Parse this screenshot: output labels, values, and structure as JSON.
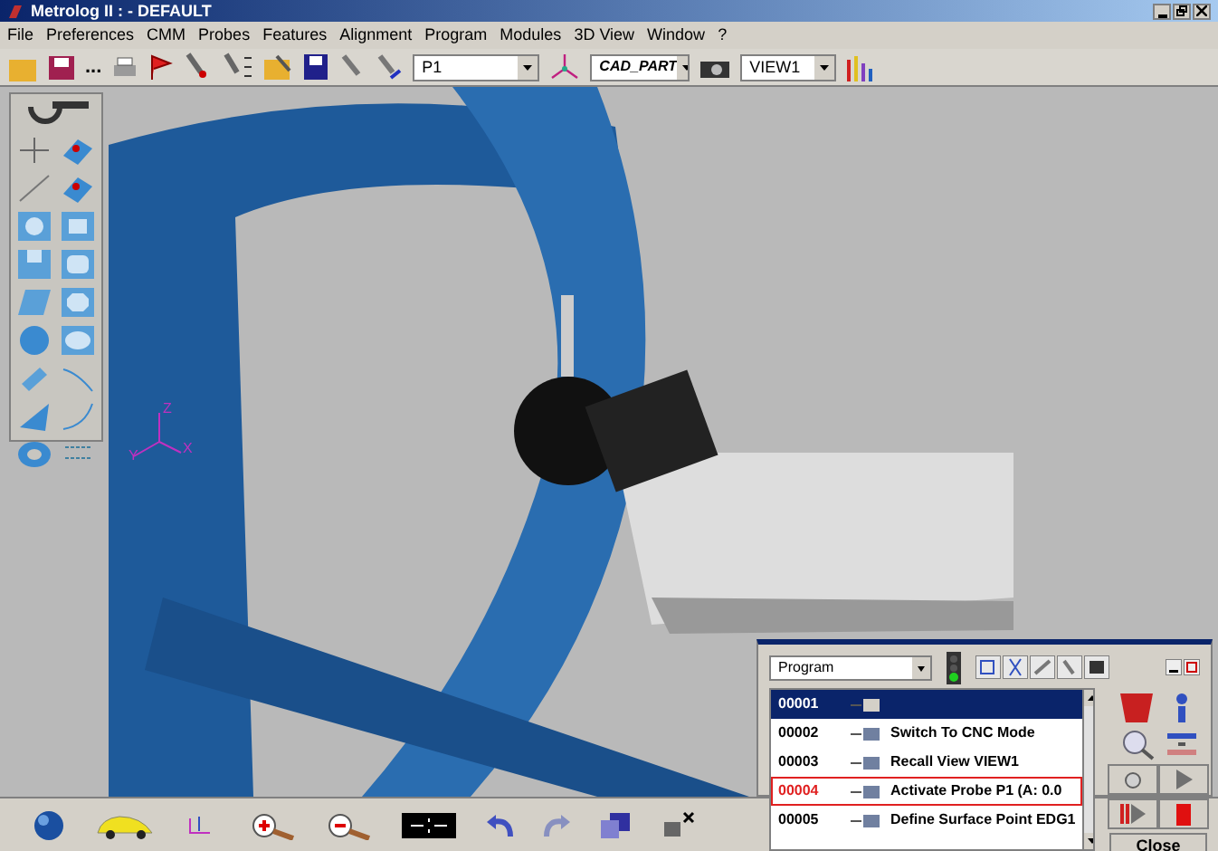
{
  "window": {
    "title": "Metrolog II : - DEFAULT"
  },
  "menu": [
    "File",
    "Preferences",
    "CMM",
    "Probes",
    "Features",
    "Alignment",
    "Program",
    "Modules",
    "3D View",
    "Window",
    "?"
  ],
  "toolbar": {
    "ellipsis": "...",
    "probe_select": "P1",
    "part_select": "CAD_PART",
    "view_select": "VIEW1"
  },
  "viewport": {
    "axis_labels": [
      "Z",
      "Y",
      "X"
    ]
  },
  "program_panel": {
    "mode_select": "Program",
    "rows": [
      {
        "number": "00001",
        "text": "",
        "selected": true,
        "current": false
      },
      {
        "number": "00002",
        "text": "Switch To CNC Mode",
        "selected": false,
        "current": false
      },
      {
        "number": "00003",
        "text": "Recall View VIEW1",
        "selected": false,
        "current": false
      },
      {
        "number": "00004",
        "text": "Activate Probe  P1 (A:  0.0",
        "selected": false,
        "current": true
      },
      {
        "number": "00005",
        "text": "Define Surface Point EDG1",
        "selected": false,
        "current": false
      }
    ],
    "close_button": "Close"
  }
}
